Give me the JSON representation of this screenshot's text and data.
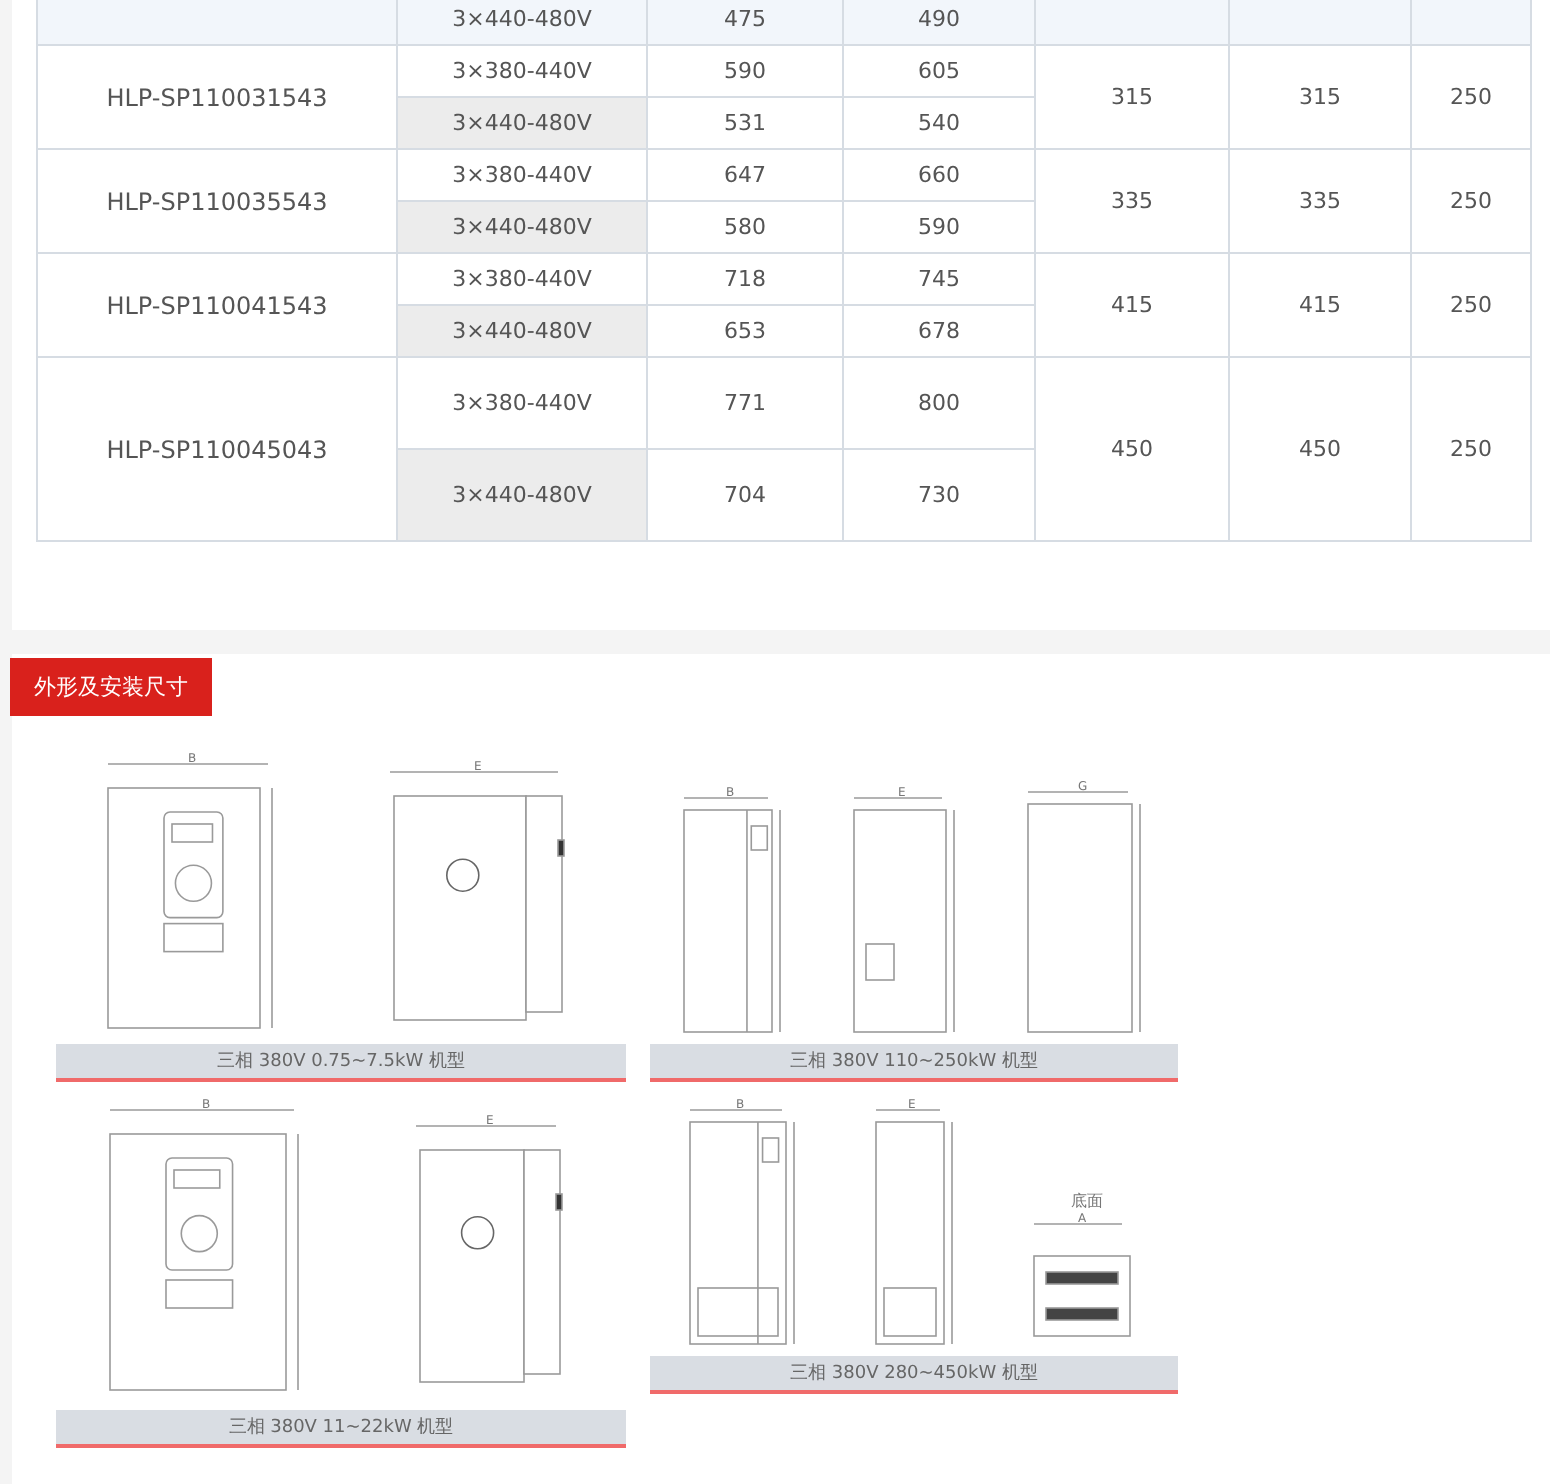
{
  "spec_table": {
    "groups": [
      {
        "tint": true,
        "rows": [
          {
            "voltage": "3×440-480V",
            "col_3": "475",
            "col_4": "490"
          }
        ]
      },
      {
        "tint": false,
        "model": "HLP-SP110031543",
        "rows": [
          {
            "voltage": "3×380-440V",
            "col_3": "590",
            "col_4": "605"
          },
          {
            "voltage": "3×440-480V",
            "col_3": "531",
            "col_4": "540"
          }
        ],
        "col_5": "315",
        "col_6": "315",
        "col_7": "250"
      },
      {
        "tint": false,
        "model": "HLP-SP110035543",
        "rows": [
          {
            "voltage": "3×380-440V",
            "col_3": "647",
            "col_4": "660"
          },
          {
            "voltage": "3×440-480V",
            "col_3": "580",
            "col_4": "590"
          }
        ],
        "col_5": "335",
        "col_6": "335",
        "col_7": "250"
      },
      {
        "tint": false,
        "model": "HLP-SP110041543",
        "rows": [
          {
            "voltage": "3×380-440V",
            "col_3": "718",
            "col_4": "745"
          },
          {
            "voltage": "3×440-480V",
            "col_3": "653",
            "col_4": "678"
          }
        ],
        "col_5": "415",
        "col_6": "415",
        "col_7": "250"
      },
      {
        "tint": false,
        "tall": true,
        "model": "HLP-SP110045043",
        "rows": [
          {
            "voltage": "3×380-440V",
            "col_3": "771",
            "col_4": "800"
          },
          {
            "voltage": "3×440-480V",
            "col_3": "704",
            "col_4": "730"
          }
        ],
        "col_5": "450",
        "col_6": "450",
        "col_7": "250"
      }
    ]
  },
  "dimensions_section": {
    "title": "外形及安装尺寸",
    "figure_rows": [
      {
        "groups": [
          {
            "caption": "三相 380V 0.75~7.5kW 机型",
            "views": [
              {
                "kind": "front-small",
                "dim": "B"
              },
              {
                "kind": "side",
                "dim": "E"
              }
            ]
          },
          {
            "caption": "三相 380V 110~250kW 机型",
            "views": [
              {
                "kind": "front-cabinet",
                "dim": "B"
              },
              {
                "kind": "side-cabinet",
                "dim": "E"
              },
              {
                "kind": "back",
                "dim": "G"
              }
            ]
          }
        ]
      },
      {
        "groups": [
          {
            "caption": "三相 380V 11~22kW 机型",
            "views": [
              {
                "kind": "front-large",
                "dim": "B"
              },
              {
                "kind": "side-large",
                "dim": "E"
              }
            ]
          },
          {
            "caption": "三相 380V 280~450kW 机型",
            "views": [
              {
                "kind": "front-tall",
                "dim": "B"
              },
              {
                "kind": "side-tall",
                "dim": "E"
              },
              {
                "kind": "bottom",
                "dim": "A",
                "title": "底面"
              }
            ]
          }
        ]
      }
    ]
  }
}
